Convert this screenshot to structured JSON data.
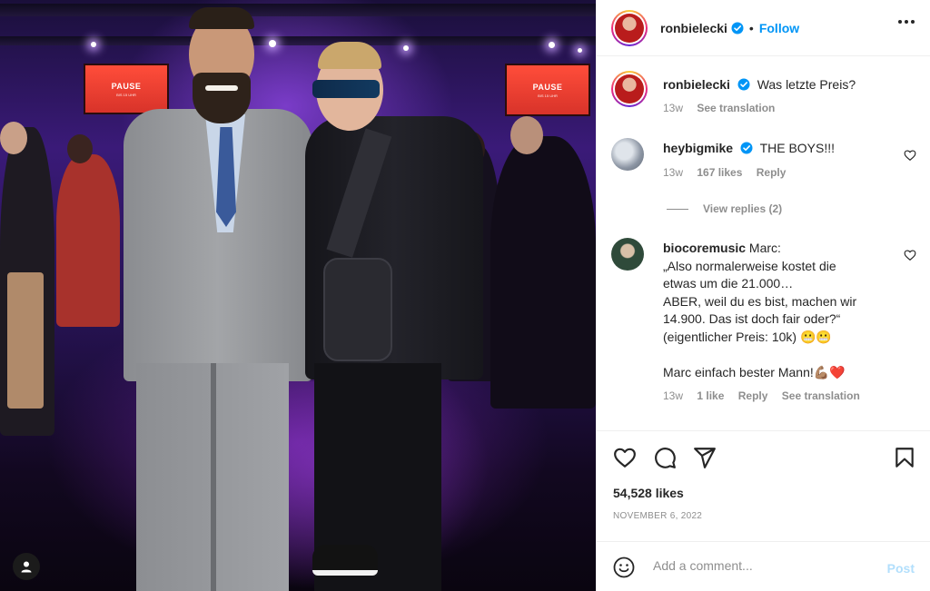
{
  "post": {
    "author": "ronbielecki",
    "follow_label": "Follow",
    "separator": "•",
    "caption": "Was letzte Preis?",
    "caption_time": "13w",
    "see_translation": "See translation",
    "likes": "54,528 likes",
    "date": "NOVEMBER 6, 2022"
  },
  "photo": {
    "screens": [
      {
        "title": "PAUSE",
        "sub": "BIS 15 UHR"
      },
      {
        "title": "PAUSE",
        "sub": "BIS 15 UHR"
      }
    ]
  },
  "comments": [
    {
      "user": "heybigmike",
      "text": "THE BOYS!!!",
      "time": "13w",
      "likes": "167 likes",
      "reply": "Reply",
      "view_replies": "View replies (2)"
    },
    {
      "user": "biocoremusic",
      "lines": [
        "Marc:",
        "„Also normalerweise kostet die",
        "etwas um die 21.000…",
        "ABER, weil du es bist, machen wir",
        "14.900. Das ist doch fair oder?“",
        "(eigentlicher Preis: 10k) 😬😬",
        "",
        "Marc einfach bester Mann!💪🏽❤️"
      ],
      "time": "13w",
      "likes": "1 like",
      "reply": "Reply",
      "see_translation": "See translation"
    }
  ],
  "add_comment": {
    "placeholder": "Add a comment...",
    "post_label": "Post"
  },
  "icons": {
    "verified": "verified-badge-icon",
    "more": "more-options-icon",
    "heart": "heart-icon",
    "comment": "comment-icon",
    "share": "share-icon",
    "save": "bookmark-icon",
    "emoji": "emoji-icon",
    "user": "user-icon"
  },
  "colors": {
    "accent": "#0095f6",
    "muted": "#8e8e8e",
    "post_disabled": "#b2dffc",
    "verified": "#0095f6"
  }
}
